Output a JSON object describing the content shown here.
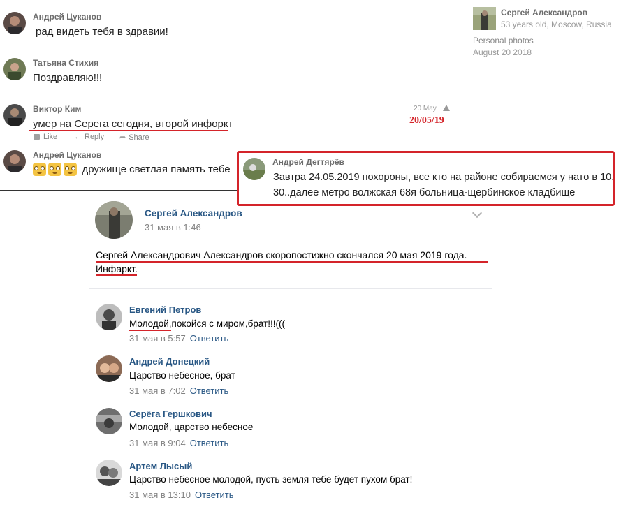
{
  "top_comments": [
    {
      "author": "Андрей Цуканов",
      "text": "рад видеть тебя в здравии!"
    },
    {
      "author": "Татьяна Стихия",
      "text": "Поздравляю!!!"
    },
    {
      "author": "Виктор Ким",
      "text": "умер на Серега сегодня, второй инфоркт",
      "date": "20 May",
      "annotation": "20/05/19",
      "actions": {
        "like": "Like",
        "reply": "Reply",
        "share": "Share"
      }
    },
    {
      "author": "Андрей Цуканов",
      "text": "дружище светлая память тебе"
    }
  ],
  "highlighted_comment": {
    "author": "Андрей Дегтярёв",
    "line1": "Завтра 24.05.2019 похороны, все кто на районе собираемся у нато в 10.",
    "line2": "30..далее метро волжская 68я больница-щербинское кладбище"
  },
  "profile_card": {
    "name": "Сергей Александров",
    "info": "53 years old, Moscow, Russia",
    "album": "Personal photos",
    "date": "August 20 2018"
  },
  "post": {
    "author": "Сергей Александров",
    "date": "31 мая в 1:46",
    "text_line1": "Сергей Александрович Александров скоропостижно скончался 20 мая 2019 года.",
    "text_line2": "Инфаркт."
  },
  "replies_label": "Ответить",
  "comments": [
    {
      "author": "Евгений Петров",
      "text": "Молодой,покойся с миром,брат!!!(((",
      "date": "31 мая в 5:57"
    },
    {
      "author": "Андрей Донецкий",
      "text": "Царство небесное, брат",
      "date": "31 мая в 7:02"
    },
    {
      "author": "Серёга Гершкович",
      "text": "Молодой, царство небесное",
      "date": "31 мая в 9:04"
    },
    {
      "author": "Артем Лысый",
      "text": "Царство небесное молодой, пусть земля тебе будет пухом брат!",
      "date": "31 мая в 13:10"
    }
  ],
  "colors": {
    "vk_blue": "#2a5885",
    "annotation_red": "#d4242a"
  }
}
